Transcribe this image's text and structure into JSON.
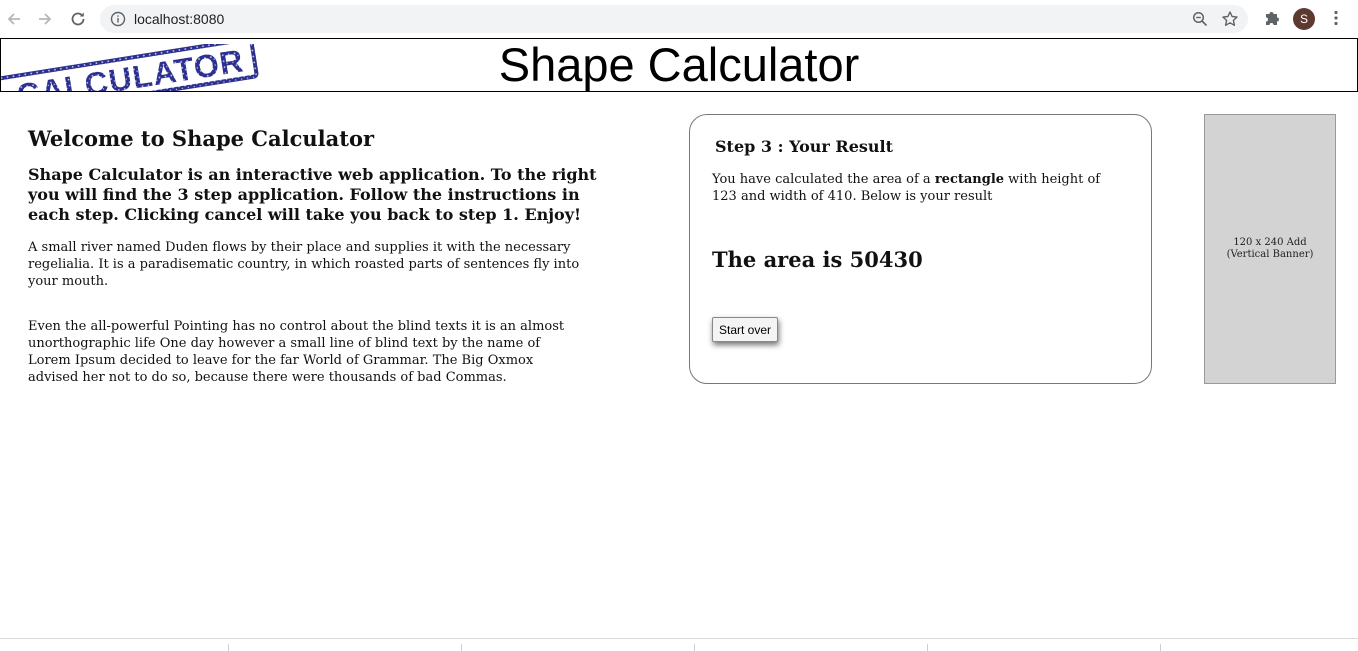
{
  "browser": {
    "url": "localhost:8080",
    "profile_initial": "S",
    "icons": [
      "back-icon",
      "forward-icon",
      "reload-icon",
      "info-icon",
      "zoom-icon",
      "star-icon",
      "extensions-icon",
      "menu-icon"
    ]
  },
  "header": {
    "title": "Shape Calculator",
    "stamp_text": "CALCULATOR",
    "stamp_color": "#2b2f8f"
  },
  "intro": {
    "heading": "Welcome to Shape Calculator",
    "lead": "Shape Calculator is an interactive web application. To the right you will find the 3 step application. Follow the instructions in each step. Clicking cancel will take you back to step 1. Enjoy!",
    "paragraph1": "A small river named Duden flows by their place and supplies it with the necessary regelialia. It is a paradisematic country, in which roasted parts of sentences fly into your mouth.",
    "paragraph2": "Even the all-powerful Pointing has no control about the blind texts it is an almost unorthographic life One day however a small line of blind text by the name of Lorem Ipsum decided to leave for the far World of Grammar. The Big Oxmox advised her not to do so, because there were thousands of bad Commas."
  },
  "result": {
    "step_title": "Step 3 : Your Result",
    "desc_before": "You have calculated the area of a ",
    "shape": "rectangle",
    "desc_after": " with height of 123 and width of 410. Below is your result",
    "area_text": "The area is 50430",
    "start_over_label": "Start over"
  },
  "ad": {
    "line1": "120 x 240 Add",
    "line2": "(Vertical Banner)"
  }
}
